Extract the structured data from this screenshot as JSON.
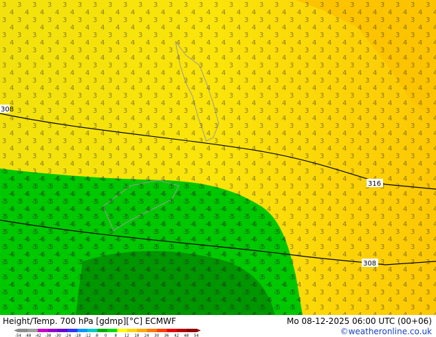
{
  "footer": {
    "title": "Height/Temp. 700 hPa [gdmp][°C] ECMWF",
    "run": "Mo 08-12-2025 06:00 UTC (00+06)",
    "credit": "©weatheronline.co.uk"
  },
  "legend": {
    "ticks": [
      "-54",
      "-48",
      "-42",
      "-38",
      "-30",
      "-24",
      "-18",
      "-12",
      "-8",
      "0",
      "8",
      "12",
      "18",
      "24",
      "30",
      "36",
      "42",
      "48",
      "54"
    ],
    "colors": [
      "#8c8c8c",
      "#a0a0a0",
      "#c800c8",
      "#9600c8",
      "#6400d2",
      "#3232ff",
      "#0096ff",
      "#00c8c8",
      "#00aa00",
      "#00dc00",
      "#ffff00",
      "#ffd700",
      "#ffaa00",
      "#ff7800",
      "#ff3c00",
      "#e60000",
      "#b40000",
      "#8c0000"
    ]
  },
  "contour_labels": [
    "308",
    "316",
    "308"
  ]
}
